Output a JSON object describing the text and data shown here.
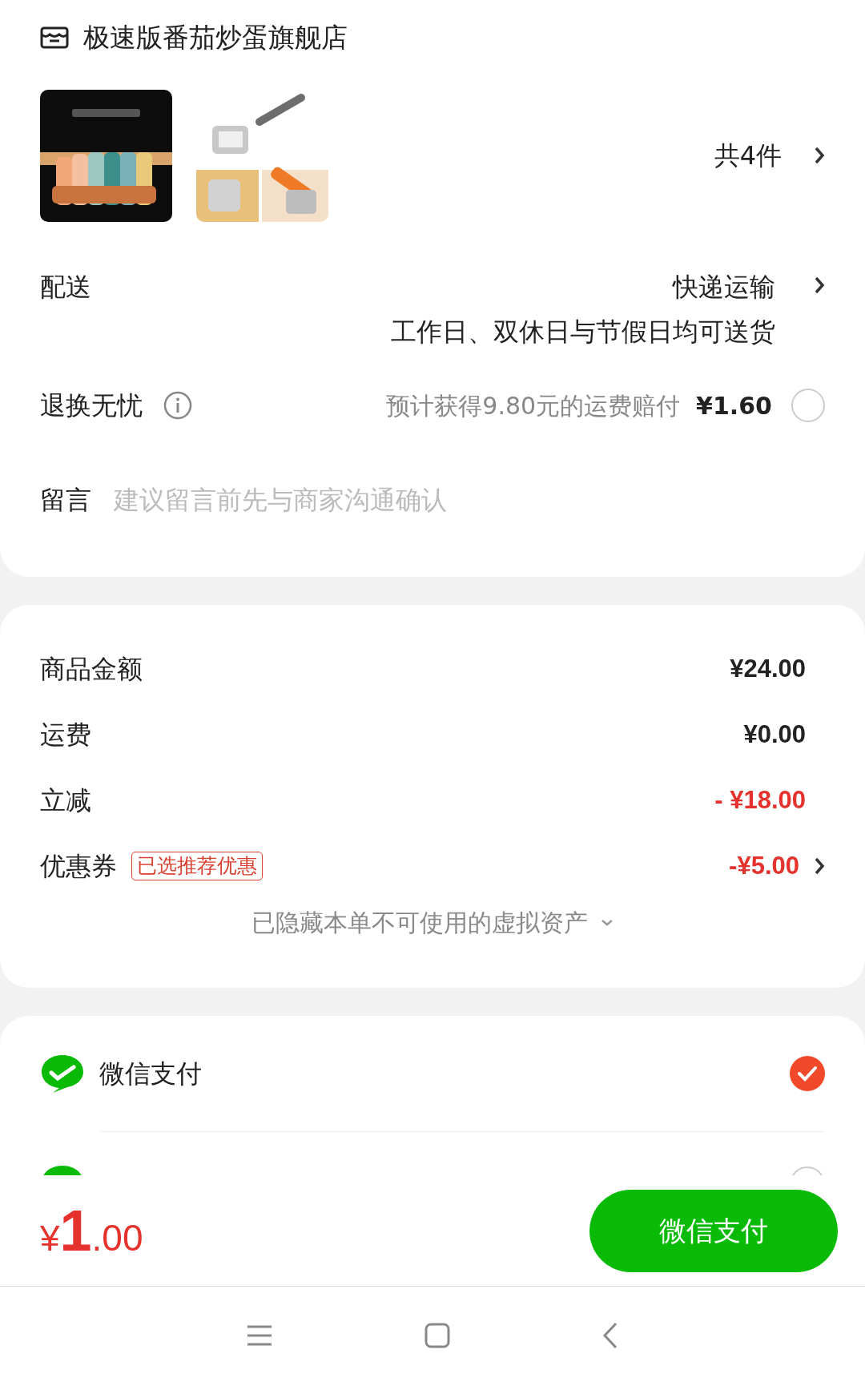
{
  "store": {
    "name": "极速版番茄炒蛋旗舰店"
  },
  "item_count": "共4件",
  "delivery": {
    "label": "配送",
    "method": "快递运输",
    "note": "工作日、双休日与节假日均可送货"
  },
  "return_insurance": {
    "label": "退换无忧",
    "description": "预计获得9.80元的运费赔付",
    "price": "¥1.60",
    "selected": false
  },
  "message": {
    "label": "留言",
    "placeholder": "建议留言前先与商家沟通确认"
  },
  "summary": [
    {
      "kind": "plain",
      "label": "商品金额",
      "value": "¥24.00"
    },
    {
      "kind": "plain",
      "label": "运费",
      "value": "¥0.00"
    },
    {
      "kind": "discount",
      "label": "立减",
      "value": "- ¥18.00"
    },
    {
      "kind": "coupon",
      "label": "优惠券",
      "badge": "已选推荐优惠",
      "value": "-¥5.00"
    }
  ],
  "hidden_assets": "已隐藏本单不可使用的虚拟资产",
  "payment_methods": [
    {
      "label": "微信支付",
      "selected": true
    },
    {
      "selected": false
    }
  ],
  "total": {
    "currency": "¥",
    "integer": "1",
    "decimal": ".00"
  },
  "pay_button": "微信支付"
}
